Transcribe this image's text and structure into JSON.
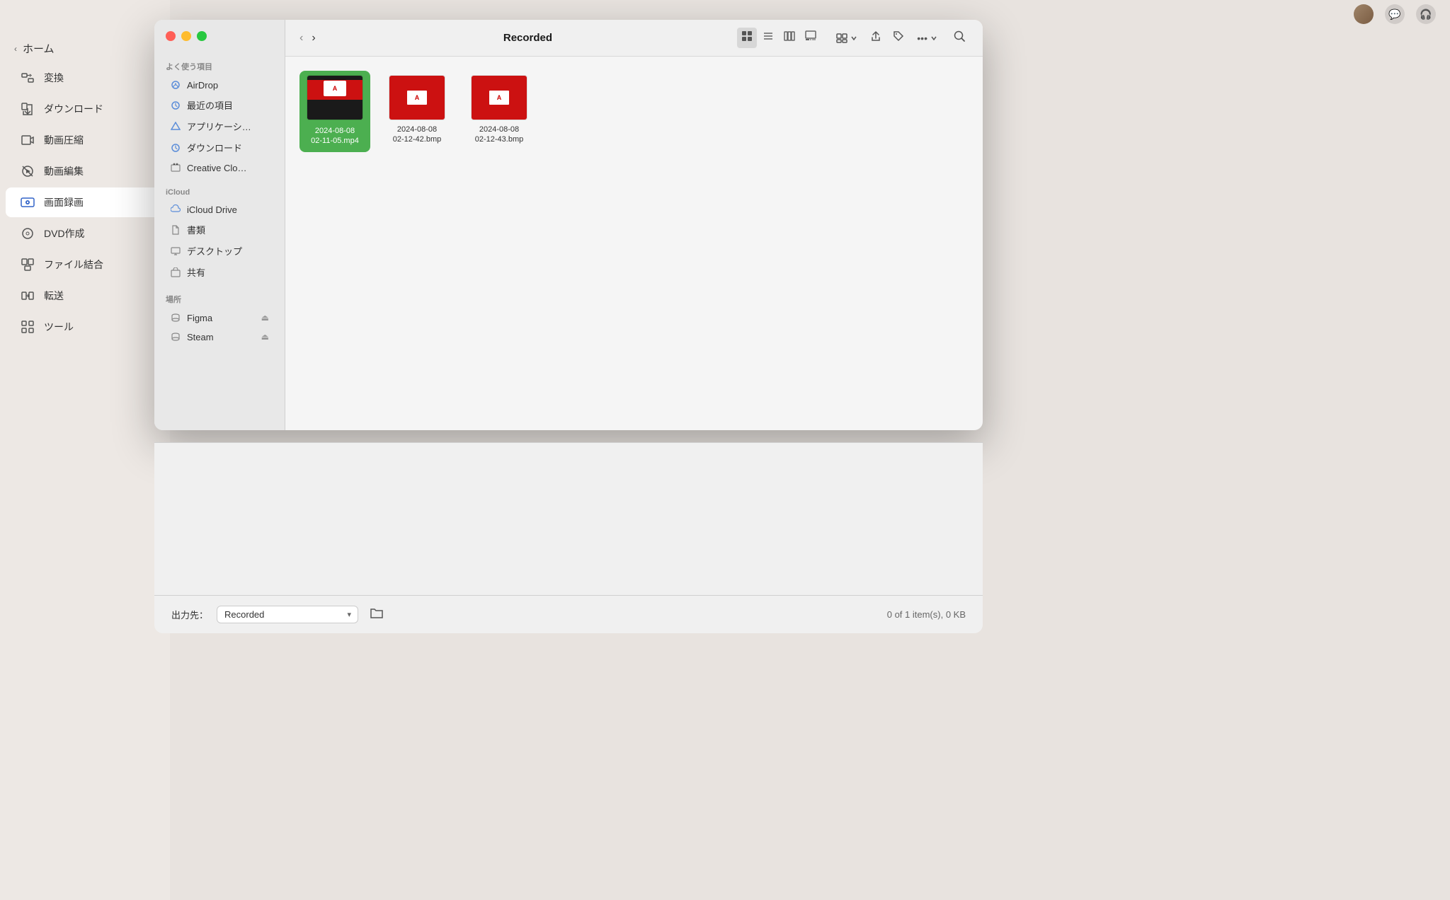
{
  "app": {
    "title": "画面録画",
    "top_bar": {
      "avatar_alt": "user avatar",
      "chat_icon": "message-icon",
      "headset_icon": "headset-icon"
    }
  },
  "app_sidebar": {
    "home_label": "ホーム",
    "items": [
      {
        "id": "convert",
        "label": "変換",
        "icon": "⬛"
      },
      {
        "id": "download",
        "label": "ダウンロード",
        "icon": "⬇"
      },
      {
        "id": "video-compress",
        "label": "動画圧縮",
        "icon": "🎬"
      },
      {
        "id": "video-edit",
        "label": "動画編集",
        "icon": "✂"
      },
      {
        "id": "screen-record",
        "label": "画面録画",
        "icon": "📺",
        "active": true
      },
      {
        "id": "dvd",
        "label": "DVD作成",
        "icon": "💿"
      },
      {
        "id": "file-merge",
        "label": "ファイル結合",
        "icon": "🗂"
      },
      {
        "id": "transfer",
        "label": "転送",
        "icon": "📋"
      },
      {
        "id": "tools",
        "label": "ツール",
        "icon": "⚙"
      }
    ]
  },
  "finder": {
    "title": "Recorded",
    "sidebar": {
      "favorites_label": "よく使う項目",
      "favorites": [
        {
          "id": "airdrop",
          "label": "AirDrop",
          "icon": "📡"
        },
        {
          "id": "recent",
          "label": "最近の項目",
          "icon": "🕒"
        },
        {
          "id": "applications",
          "label": "アプリケーシ…",
          "icon": "🔺"
        },
        {
          "id": "downloads",
          "label": "ダウンロード",
          "icon": "🕒"
        },
        {
          "id": "creative-cloud",
          "label": "Creative Clo…",
          "icon": "📁"
        }
      ],
      "icloud_label": "iCloud",
      "icloud_items": [
        {
          "id": "icloud-drive",
          "label": "iCloud Drive",
          "icon": "☁"
        },
        {
          "id": "documents",
          "label": "書類",
          "icon": "📄"
        },
        {
          "id": "desktop",
          "label": "デスクトップ",
          "icon": "🖥"
        },
        {
          "id": "shared",
          "label": "共有",
          "icon": "📁"
        }
      ],
      "locations_label": "場所",
      "location_items": [
        {
          "id": "figma",
          "label": "Figma",
          "icon": "💾",
          "eject": true
        },
        {
          "id": "steam",
          "label": "Steam",
          "icon": "💾",
          "eject": true
        }
      ]
    },
    "toolbar": {
      "back_label": "‹",
      "forward_label": "›",
      "view_icon_label": "⊞",
      "list_icon_label": "☰",
      "column_icon_label": "⋮⋮",
      "gallery_icon_label": "⊡",
      "group_label": "⊞",
      "share_label": "⬆",
      "tag_label": "🏷",
      "more_label": "…",
      "search_label": "🔍"
    },
    "files": [
      {
        "id": "file1",
        "name": "2024-08-08\n02-11-05.mp4",
        "type": "mp4",
        "selected": true
      },
      {
        "id": "file2",
        "name": "2024-08-08\n02-12-42.bmp",
        "type": "bmp",
        "selected": false
      },
      {
        "id": "file3",
        "name": "2024-08-08\n02-12-43.bmp",
        "type": "bmp",
        "selected": false
      }
    ]
  },
  "bottom_panel": {
    "output_label": "出力先：",
    "output_value": "Recorded",
    "item_count": "0 of 1 item(s), 0 KB"
  }
}
